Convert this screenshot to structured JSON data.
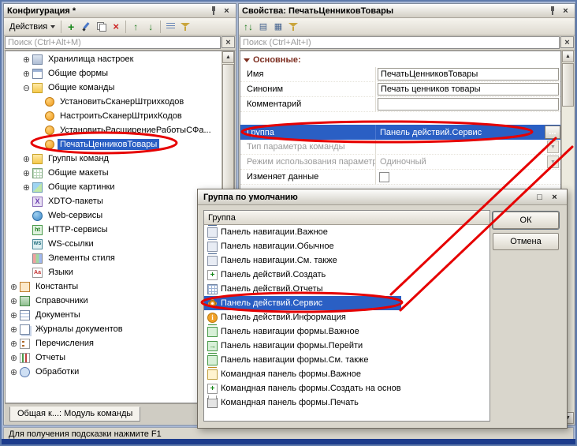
{
  "window": {
    "status_text": "Для получения подсказки нажмите F1"
  },
  "config_panel": {
    "title": "Конфигурация *",
    "toolbar": {
      "actions_label": "Действия"
    },
    "search_placeholder": "Поиск (Ctrl+Alt+M)",
    "bottom_tab": "Общая к...: Модуль команды",
    "tree": [
      {
        "label": "Хранилища настроек",
        "level": 1,
        "expander": "plus",
        "icon": "storage"
      },
      {
        "label": "Общие формы",
        "level": 1,
        "expander": "plus",
        "icon": "form"
      },
      {
        "label": "Общие команды",
        "level": 1,
        "expander": "minus",
        "icon": "cmdfolder"
      },
      {
        "label": "УстановитьСканерШтрихкодов",
        "level": 2,
        "expander": "none",
        "icon": "command"
      },
      {
        "label": "НастроитьСканерШтрихКодов",
        "level": 2,
        "expander": "none",
        "icon": "command"
      },
      {
        "label": "УстановитьРасширениеРаботыСФа...",
        "level": 2,
        "expander": "none",
        "icon": "command"
      },
      {
        "label": "ПечатьЦенниковТовары",
        "level": 2,
        "expander": "none",
        "icon": "command",
        "selected": true
      },
      {
        "label": "Группы команд",
        "level": 1,
        "expander": "plus",
        "icon": "folder"
      },
      {
        "label": "Общие макеты",
        "level": 1,
        "expander": "plus",
        "icon": "layout"
      },
      {
        "label": "Общие картинки",
        "level": 1,
        "expander": "plus",
        "icon": "picture"
      },
      {
        "label": "XDTO-пакеты",
        "level": 1,
        "expander": "none",
        "icon": "xdto"
      },
      {
        "label": "Web-сервисы",
        "level": 1,
        "expander": "none",
        "icon": "web"
      },
      {
        "label": "HTTP-сервисы",
        "level": 1,
        "expander": "none",
        "icon": "http"
      },
      {
        "label": "WS-ссылки",
        "level": 1,
        "expander": "none",
        "icon": "ws"
      },
      {
        "label": "Элементы стиля",
        "level": 1,
        "expander": "none",
        "icon": "style"
      },
      {
        "label": "Языки",
        "level": 1,
        "expander": "none",
        "icon": "lang"
      },
      {
        "label": "Константы",
        "level": 0,
        "expander": "plus",
        "icon": "const"
      },
      {
        "label": "Справочники",
        "level": 0,
        "expander": "plus",
        "icon": "catalog"
      },
      {
        "label": "Документы",
        "level": 0,
        "expander": "plus",
        "icon": "doc"
      },
      {
        "label": "Журналы документов",
        "level": 0,
        "expander": "plus",
        "icon": "journal"
      },
      {
        "label": "Перечисления",
        "level": 0,
        "expander": "plus",
        "icon": "enum"
      },
      {
        "label": "Отчеты",
        "level": 0,
        "expander": "plus",
        "icon": "report"
      },
      {
        "label": "Обработки",
        "level": 0,
        "expander": "plus",
        "icon": "processing"
      }
    ]
  },
  "props_panel": {
    "title": "Свойства: ПечатьЦенниковТовары",
    "search_placeholder": "Поиск (Ctrl+Alt+I)",
    "section_label": "Основные:",
    "rows": [
      {
        "key": "name",
        "label": "Имя",
        "value": "ПечатьЦенниковТовары",
        "type": "box"
      },
      {
        "key": "synonym",
        "label": "Синоним",
        "value": "Печать ценников товары",
        "type": "box"
      },
      {
        "key": "comment",
        "label": "Комментарий",
        "value": "",
        "type": "box"
      },
      {
        "key": "group",
        "label": "Группа",
        "value": "Панель действий.Сервис",
        "type": "group",
        "gap_before": true,
        "buttons": {
          "ellipsis": "...",
          "clear": "×"
        }
      },
      {
        "key": "param-type",
        "label": "Тип параметра команды",
        "value": "",
        "type": "dropdown",
        "disabled": true
      },
      {
        "key": "param-mode",
        "label": "Режим использования параметра",
        "value": "Одиночный",
        "type": "dropdown",
        "disabled": true
      },
      {
        "key": "modifies-data",
        "label": "Изменяет данные",
        "value": "",
        "type": "checkbox"
      }
    ]
  },
  "dialog": {
    "title": "Группа по умолчанию",
    "column_header": "Группа",
    "ok_label": "ОК",
    "cancel_label": "Отмена",
    "items": [
      {
        "label": "Панель навигации.Важное",
        "icon": "nav1"
      },
      {
        "label": "Панель навигации.Обычное",
        "icon": "nav2"
      },
      {
        "label": "Панель навигации.См. также",
        "icon": "nav3"
      },
      {
        "label": "Панель действий.Создать",
        "icon": "create"
      },
      {
        "label": "Панель действий.Отчеты",
        "icon": "reports"
      },
      {
        "label": "Панель действий.Сервис",
        "icon": "service",
        "selected": true
      },
      {
        "label": "Панель действий.Информация",
        "icon": "info"
      },
      {
        "label": "Панель навигации формы.Важное",
        "icon": "fnav1"
      },
      {
        "label": "Панель навигации формы.Перейти",
        "icon": "goto"
      },
      {
        "label": "Панель навигации формы.См. также",
        "icon": "fnav2"
      },
      {
        "label": "Командная панель формы.Важное",
        "icon": "cmd1"
      },
      {
        "label": "Командная панель формы.Создать на основании",
        "icon": "createbased"
      },
      {
        "label": "Командная панель формы.Печать",
        "icon": "print"
      }
    ]
  }
}
